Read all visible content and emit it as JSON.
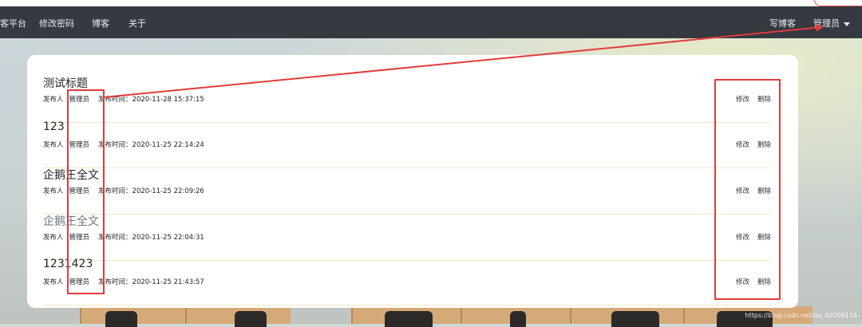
{
  "navbar": {
    "brand_fragment": "客平台",
    "links": [
      "修改密码",
      "博客",
      "关于"
    ],
    "write_blog": "写博客",
    "user_menu": "管理员"
  },
  "posts": [
    {
      "title": "测试标题",
      "author_label": "发布人",
      "author": "管理员",
      "time_label": "发布时间：",
      "time": "2020-11-28 15:37:15",
      "edit": "修改",
      "delete": "删除"
    },
    {
      "title": "123",
      "author_label": "发布人",
      "author": "管理员",
      "time_label": "发布时间：",
      "time": "2020-11-25 22:14:24",
      "edit": "修改",
      "delete": "删除"
    },
    {
      "title": "企鹅王全文",
      "author_label": "发布人",
      "author": "管理员",
      "time_label": "发布时间：",
      "time": "2020-11-25 22:09:26",
      "edit": "修改",
      "delete": "删除"
    },
    {
      "title": "企鹅王全文",
      "author_label": "发布人",
      "author": "管理员",
      "time_label": "发布时间：",
      "time": "2020-11-25 22:04:31",
      "edit": "修改",
      "delete": "删除"
    },
    {
      "title": "1231423",
      "author_label": "发布人",
      "author": "管理员",
      "time_label": "发布时间：",
      "time": "2020-11-25 21:43:57",
      "edit": "修改",
      "delete": "删除"
    }
  ],
  "watermark": "https://blog.csdn.net/qq_40206116",
  "colors": {
    "navbar": "#343a40",
    "annotation": "#e03c3c",
    "divider": "#efe7c7"
  }
}
